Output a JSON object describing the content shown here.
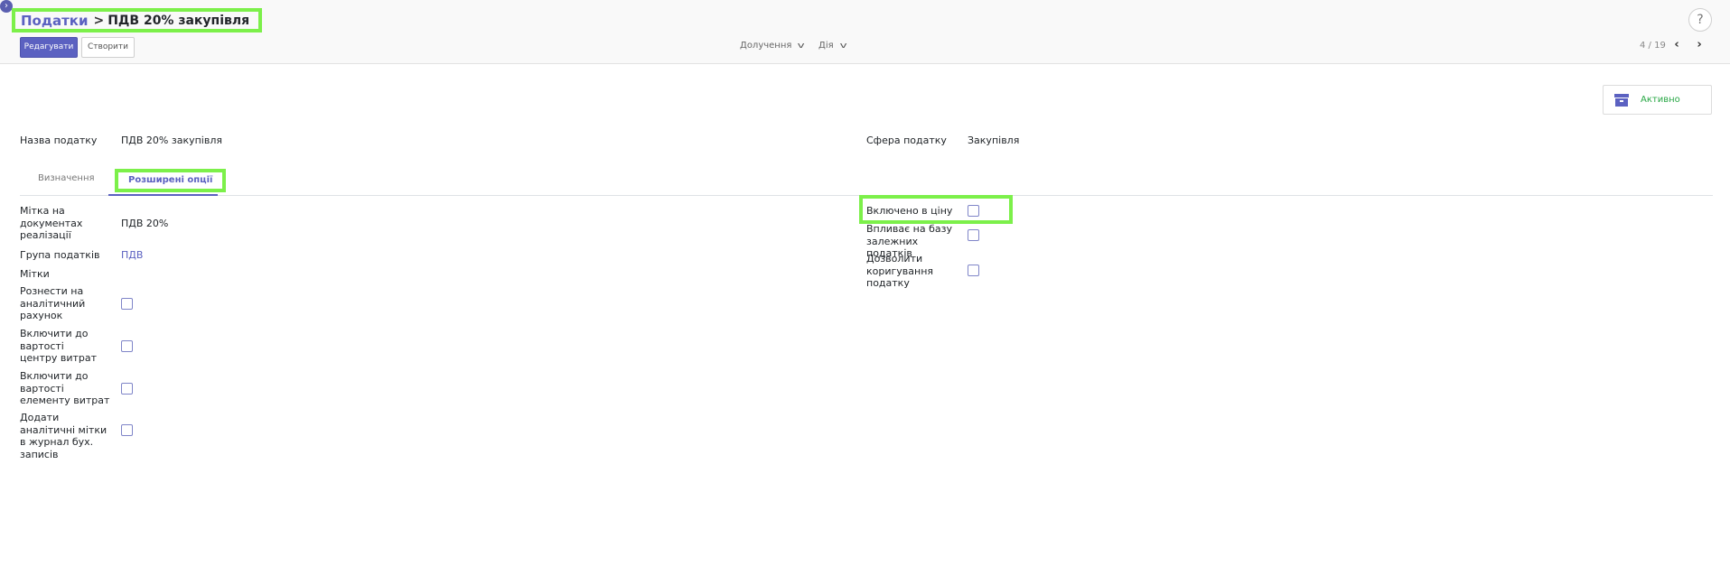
{
  "header": {
    "corner_icon": "chevron-right-icon",
    "breadcrumb_parent": "Податки",
    "breadcrumb_separator": ">",
    "breadcrumb_current": "ПДВ 20% закупівля",
    "help_label": "?"
  },
  "toolbar": {
    "edit_label": "Редагувати",
    "create_label": "Створити",
    "attachments_label": "Долучення",
    "action_label": "Дія",
    "pager_text": "4 / 19",
    "pager_prev": "‹",
    "pager_next": "›"
  },
  "status": {
    "label": "Активно",
    "icon": "archive-icon",
    "color": "#28a745"
  },
  "form": {
    "tax_name_label": "Назва податку",
    "tax_name_value": "ПДВ 20% закупівля",
    "tax_scope_label": "Сфера податку",
    "tax_scope_value": "Закупівля"
  },
  "tabs": [
    {
      "label": "Визначення",
      "active": false
    },
    {
      "label": "Розширені опції",
      "active": true
    }
  ],
  "advanced": {
    "invoice_label_label": "Мітка на документах реалізації",
    "invoice_label_value": "ПДВ 20%",
    "tax_group_label": "Група податків",
    "tax_group_value": "ПДВ",
    "tags_label": "Мітки",
    "analytic_label": "Рознести на аналітичний рахунок",
    "analytic_checked": false,
    "cost_center_label": "Включити до вартості центру витрат",
    "cost_center_checked": false,
    "cost_element_label": "Включити до вартості елементу витрат",
    "cost_element_checked": false,
    "analytic_tags_label": "Додати аналітичні мітки в журнал бух. записів",
    "analytic_tags_checked": false,
    "price_include_label": "Включено в ціну",
    "price_include_checked": false,
    "affects_base_label": "Впливає на базу залежних податків",
    "affects_base_checked": false,
    "allow_adjust_label": "Дозволити коригування податку",
    "allow_adjust_checked": false
  },
  "colors": {
    "accent": "#5b61c1",
    "highlight": "#7cf04a"
  }
}
